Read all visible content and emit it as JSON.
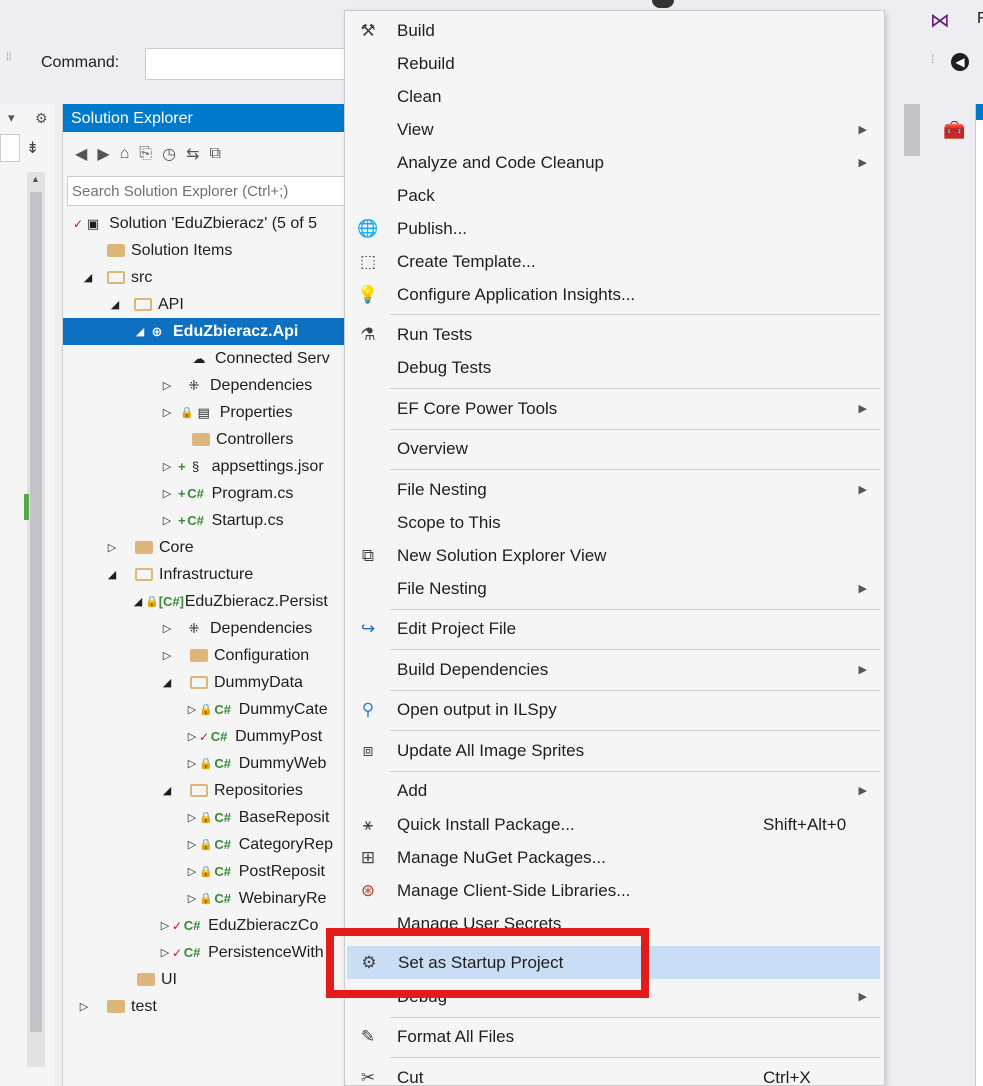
{
  "command_bar": {
    "label": "Command:",
    "value": ""
  },
  "solution_explorer": {
    "title": "Solution Explorer",
    "search_placeholder": "Search Solution Explorer (Ctrl+;)",
    "tree": [
      {
        "label": "Solution 'EduZbieracz' (5 of 5"
      },
      {
        "label": "Solution Items"
      },
      {
        "label": "src"
      },
      {
        "label": "API"
      },
      {
        "label": "EduZbieracz.Api"
      },
      {
        "label": "Connected Serv"
      },
      {
        "label": "Dependencies"
      },
      {
        "label": "Properties"
      },
      {
        "label": "Controllers"
      },
      {
        "label": "appsettings.jsor"
      },
      {
        "label": "Program.cs"
      },
      {
        "label": "Startup.cs"
      },
      {
        "label": "Core"
      },
      {
        "label": "Infrastructure"
      },
      {
        "label": "EduZbieracz.Persist"
      },
      {
        "label": "Dependencies"
      },
      {
        "label": "Configuration"
      },
      {
        "label": "DummyData"
      },
      {
        "label": "DummyCate"
      },
      {
        "label": "DummyPost"
      },
      {
        "label": "DummyWeb"
      },
      {
        "label": "Repositories"
      },
      {
        "label": "BaseReposit"
      },
      {
        "label": "CategoryRep"
      },
      {
        "label": "PostReposit"
      },
      {
        "label": "WebinaryRe"
      },
      {
        "label": "EduZbieraczCo"
      },
      {
        "label": "PersistenceWith"
      },
      {
        "label": "UI"
      },
      {
        "label": "test"
      }
    ]
  },
  "context_menu": {
    "items": [
      {
        "label": "Build",
        "icon": "build-icon"
      },
      {
        "label": "Rebuild"
      },
      {
        "label": "Clean"
      },
      {
        "label": "View",
        "submenu": true
      },
      {
        "label": "Analyze and Code Cleanup",
        "submenu": true
      },
      {
        "label": "Pack"
      },
      {
        "label": "Publish...",
        "icon": "publish-icon"
      },
      {
        "label": "Create Template...",
        "icon": "template-icon"
      },
      {
        "label": "Configure Application Insights...",
        "icon": "insights-icon"
      },
      {
        "label": "Run Tests",
        "icon": "run-tests-icon"
      },
      {
        "label": "Debug Tests"
      },
      {
        "label": "EF Core Power Tools",
        "submenu": true
      },
      {
        "label": "Overview"
      },
      {
        "label": "File Nesting",
        "submenu": true
      },
      {
        "label": "Scope to This"
      },
      {
        "label": "New Solution Explorer View",
        "icon": "new-view-icon"
      },
      {
        "label": "File Nesting",
        "submenu": true
      },
      {
        "label": "Edit Project File",
        "icon": "edit-project-icon"
      },
      {
        "label": "Build Dependencies",
        "submenu": true
      },
      {
        "label": "Open output in ILSpy",
        "icon": "ilspy-icon"
      },
      {
        "label": "Update All Image Sprites",
        "icon": "sprites-icon"
      },
      {
        "label": "Add",
        "submenu": true
      },
      {
        "label": "Quick Install Package...",
        "shortcut": "Shift+Alt+0",
        "icon": "package-icon"
      },
      {
        "label": "Manage NuGet Packages...",
        "icon": "nuget-icon"
      },
      {
        "label": "Manage Client-Side Libraries...",
        "icon": "libraries-icon"
      },
      {
        "label": "Manage User Secrets"
      },
      {
        "label": "Set as Startup Project",
        "icon": "gear-icon",
        "highlighted": true
      },
      {
        "label": "Debug",
        "submenu": true
      },
      {
        "label": "Format All Files",
        "icon": "format-icon"
      },
      {
        "label": "Cut",
        "shortcut": "Ctrl+X",
        "icon": "cut-icon"
      }
    ]
  },
  "colors": {
    "accent": "#007acc",
    "selection": "#0e70c0",
    "highlight": "#c9def5",
    "annotation": "#e41b1b"
  }
}
